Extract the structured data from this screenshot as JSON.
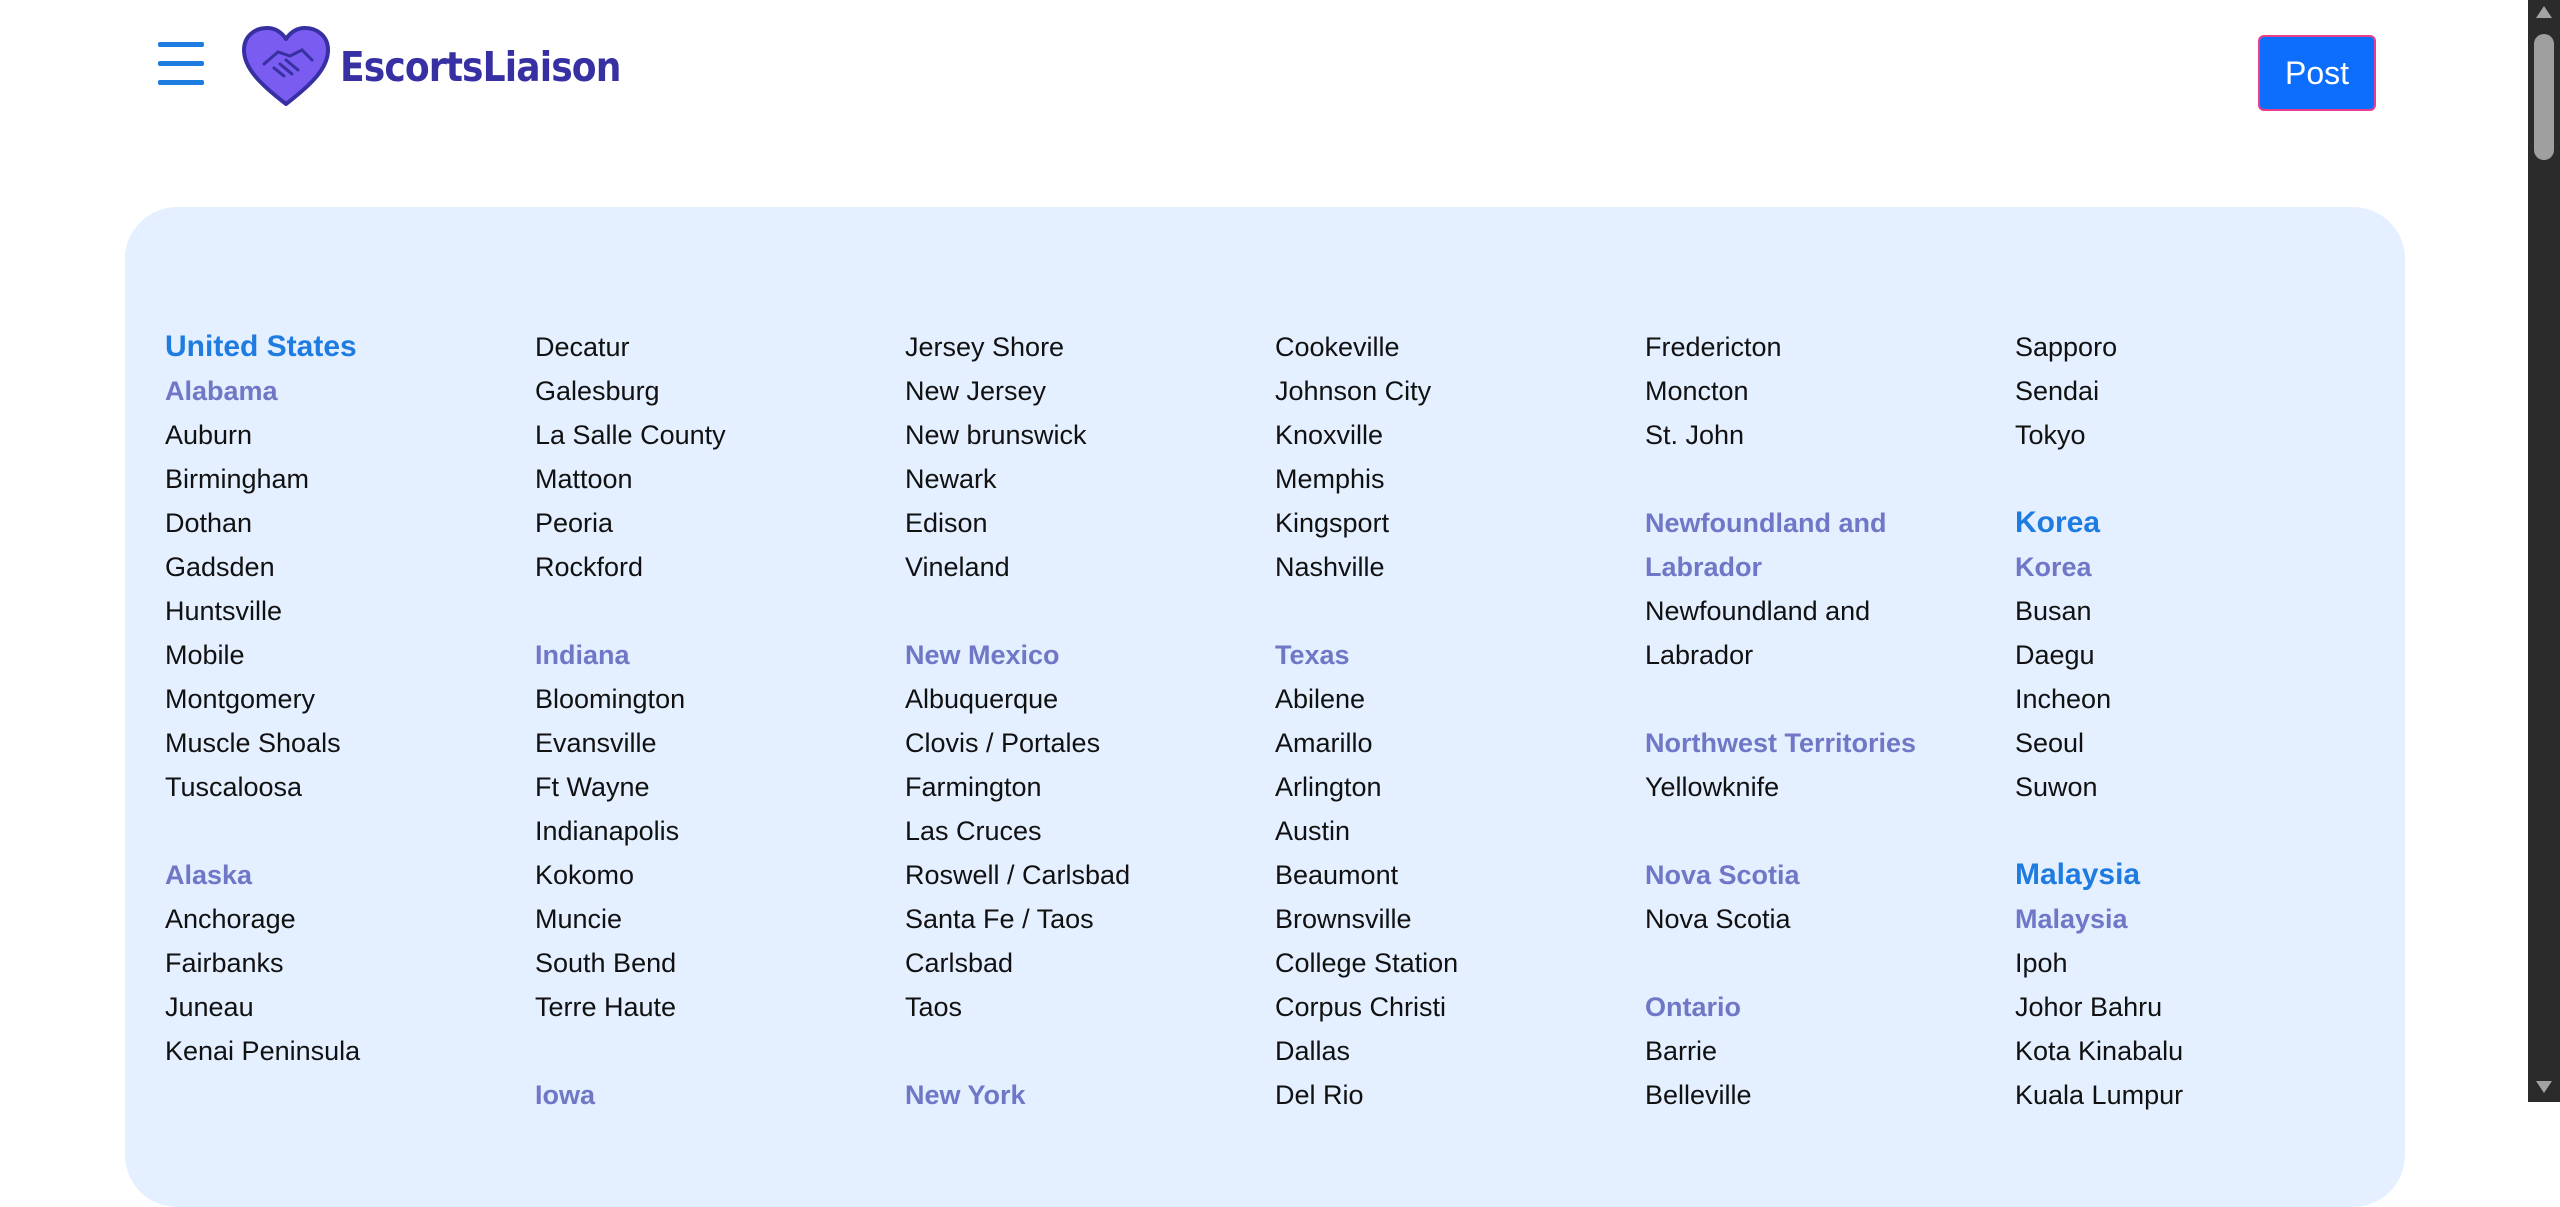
{
  "header": {
    "brand": "EscortsLiaison",
    "menu_icon": "hamburger-menu-icon",
    "logo_icon": "heart-handshake-icon",
    "post_label": "Post"
  },
  "colors": {
    "accent": "#1e7be0",
    "region": "#7077c7",
    "panel_bg": "#e4efff",
    "button_bg": "#0d6efd",
    "logo_purple": "#7b5cf0",
    "logo_dark": "#3730a3"
  },
  "columns": [
    [
      {
        "t": "country",
        "v": "United States"
      },
      {
        "t": "region",
        "v": "Alabama"
      },
      {
        "t": "city",
        "v": "Auburn"
      },
      {
        "t": "city",
        "v": "Birmingham"
      },
      {
        "t": "city",
        "v": "Dothan"
      },
      {
        "t": "city",
        "v": "Gadsden"
      },
      {
        "t": "city",
        "v": "Huntsville"
      },
      {
        "t": "city",
        "v": "Mobile"
      },
      {
        "t": "city",
        "v": "Montgomery"
      },
      {
        "t": "city",
        "v": "Muscle Shoals"
      },
      {
        "t": "city",
        "v": "Tuscaloosa"
      },
      {
        "t": "gap",
        "v": ""
      },
      {
        "t": "region",
        "v": "Alaska"
      },
      {
        "t": "city",
        "v": "Anchorage"
      },
      {
        "t": "city",
        "v": "Fairbanks"
      },
      {
        "t": "city",
        "v": "Juneau"
      },
      {
        "t": "city",
        "v": "Kenai Peninsula"
      }
    ],
    [
      {
        "t": "city",
        "v": "Decatur"
      },
      {
        "t": "city",
        "v": "Galesburg"
      },
      {
        "t": "city",
        "v": "La Salle County"
      },
      {
        "t": "city",
        "v": "Mattoon"
      },
      {
        "t": "city",
        "v": "Peoria"
      },
      {
        "t": "city",
        "v": "Rockford"
      },
      {
        "t": "gap",
        "v": ""
      },
      {
        "t": "region",
        "v": "Indiana"
      },
      {
        "t": "city",
        "v": "Bloomington"
      },
      {
        "t": "city",
        "v": "Evansville"
      },
      {
        "t": "city",
        "v": "Ft Wayne"
      },
      {
        "t": "city",
        "v": "Indianapolis"
      },
      {
        "t": "city",
        "v": "Kokomo"
      },
      {
        "t": "city",
        "v": "Muncie"
      },
      {
        "t": "city",
        "v": "South Bend"
      },
      {
        "t": "city",
        "v": "Terre Haute"
      },
      {
        "t": "gap",
        "v": ""
      },
      {
        "t": "region",
        "v": "Iowa"
      }
    ],
    [
      {
        "t": "city",
        "v": "Jersey Shore"
      },
      {
        "t": "city",
        "v": "New Jersey"
      },
      {
        "t": "city",
        "v": "New brunswick"
      },
      {
        "t": "city",
        "v": "Newark"
      },
      {
        "t": "city",
        "v": "Edison"
      },
      {
        "t": "city",
        "v": "Vineland"
      },
      {
        "t": "gap",
        "v": ""
      },
      {
        "t": "region",
        "v": "New Mexico"
      },
      {
        "t": "city",
        "v": "Albuquerque"
      },
      {
        "t": "city",
        "v": "Clovis / Portales"
      },
      {
        "t": "city",
        "v": "Farmington"
      },
      {
        "t": "city",
        "v": "Las Cruces"
      },
      {
        "t": "city",
        "v": "Roswell / Carlsbad"
      },
      {
        "t": "city",
        "v": "Santa Fe / Taos"
      },
      {
        "t": "city",
        "v": "Carlsbad"
      },
      {
        "t": "city",
        "v": "Taos"
      },
      {
        "t": "gap",
        "v": ""
      },
      {
        "t": "region",
        "v": "New York"
      }
    ],
    [
      {
        "t": "city",
        "v": "Cookeville"
      },
      {
        "t": "city",
        "v": "Johnson City"
      },
      {
        "t": "city",
        "v": "Knoxville"
      },
      {
        "t": "city",
        "v": "Memphis"
      },
      {
        "t": "city",
        "v": "Kingsport"
      },
      {
        "t": "city",
        "v": "Nashville"
      },
      {
        "t": "gap",
        "v": ""
      },
      {
        "t": "region",
        "v": "Texas"
      },
      {
        "t": "city",
        "v": "Abilene"
      },
      {
        "t": "city",
        "v": "Amarillo"
      },
      {
        "t": "city",
        "v": "Arlington"
      },
      {
        "t": "city",
        "v": "Austin"
      },
      {
        "t": "city",
        "v": "Beaumont"
      },
      {
        "t": "city",
        "v": "Brownsville"
      },
      {
        "t": "city",
        "v": "College Station"
      },
      {
        "t": "city",
        "v": "Corpus Christi"
      },
      {
        "t": "city",
        "v": "Dallas"
      },
      {
        "t": "city",
        "v": "Del Rio"
      }
    ],
    [
      {
        "t": "city",
        "v": "Fredericton"
      },
      {
        "t": "city",
        "v": "Moncton"
      },
      {
        "t": "city",
        "v": "St. John"
      },
      {
        "t": "gap",
        "v": ""
      },
      {
        "t": "region",
        "v": "Newfoundland and"
      },
      {
        "t": "region",
        "v": "Labrador"
      },
      {
        "t": "city",
        "v": "Newfoundland and"
      },
      {
        "t": "city",
        "v": "Labrador"
      },
      {
        "t": "gap",
        "v": ""
      },
      {
        "t": "region",
        "v": "Northwest Territories"
      },
      {
        "t": "city",
        "v": "Yellowknife"
      },
      {
        "t": "gap",
        "v": ""
      },
      {
        "t": "region",
        "v": "Nova Scotia"
      },
      {
        "t": "city",
        "v": "Nova Scotia"
      },
      {
        "t": "gap",
        "v": ""
      },
      {
        "t": "region",
        "v": "Ontario"
      },
      {
        "t": "city",
        "v": "Barrie"
      },
      {
        "t": "city",
        "v": "Belleville"
      }
    ],
    [
      {
        "t": "city",
        "v": "Sapporo"
      },
      {
        "t": "city",
        "v": "Sendai"
      },
      {
        "t": "city",
        "v": "Tokyo"
      },
      {
        "t": "gap",
        "v": ""
      },
      {
        "t": "country",
        "v": "Korea"
      },
      {
        "t": "region",
        "v": "Korea"
      },
      {
        "t": "city",
        "v": "Busan"
      },
      {
        "t": "city",
        "v": "Daegu"
      },
      {
        "t": "city",
        "v": "Incheon"
      },
      {
        "t": "city",
        "v": "Seoul"
      },
      {
        "t": "city",
        "v": "Suwon"
      },
      {
        "t": "gap",
        "v": ""
      },
      {
        "t": "country",
        "v": "Malaysia"
      },
      {
        "t": "region",
        "v": "Malaysia"
      },
      {
        "t": "city",
        "v": "Ipoh"
      },
      {
        "t": "city",
        "v": "Johor Bahru"
      },
      {
        "t": "city",
        "v": "Kota Kinabalu"
      },
      {
        "t": "city",
        "v": "Kuala Lumpur"
      }
    ]
  ]
}
